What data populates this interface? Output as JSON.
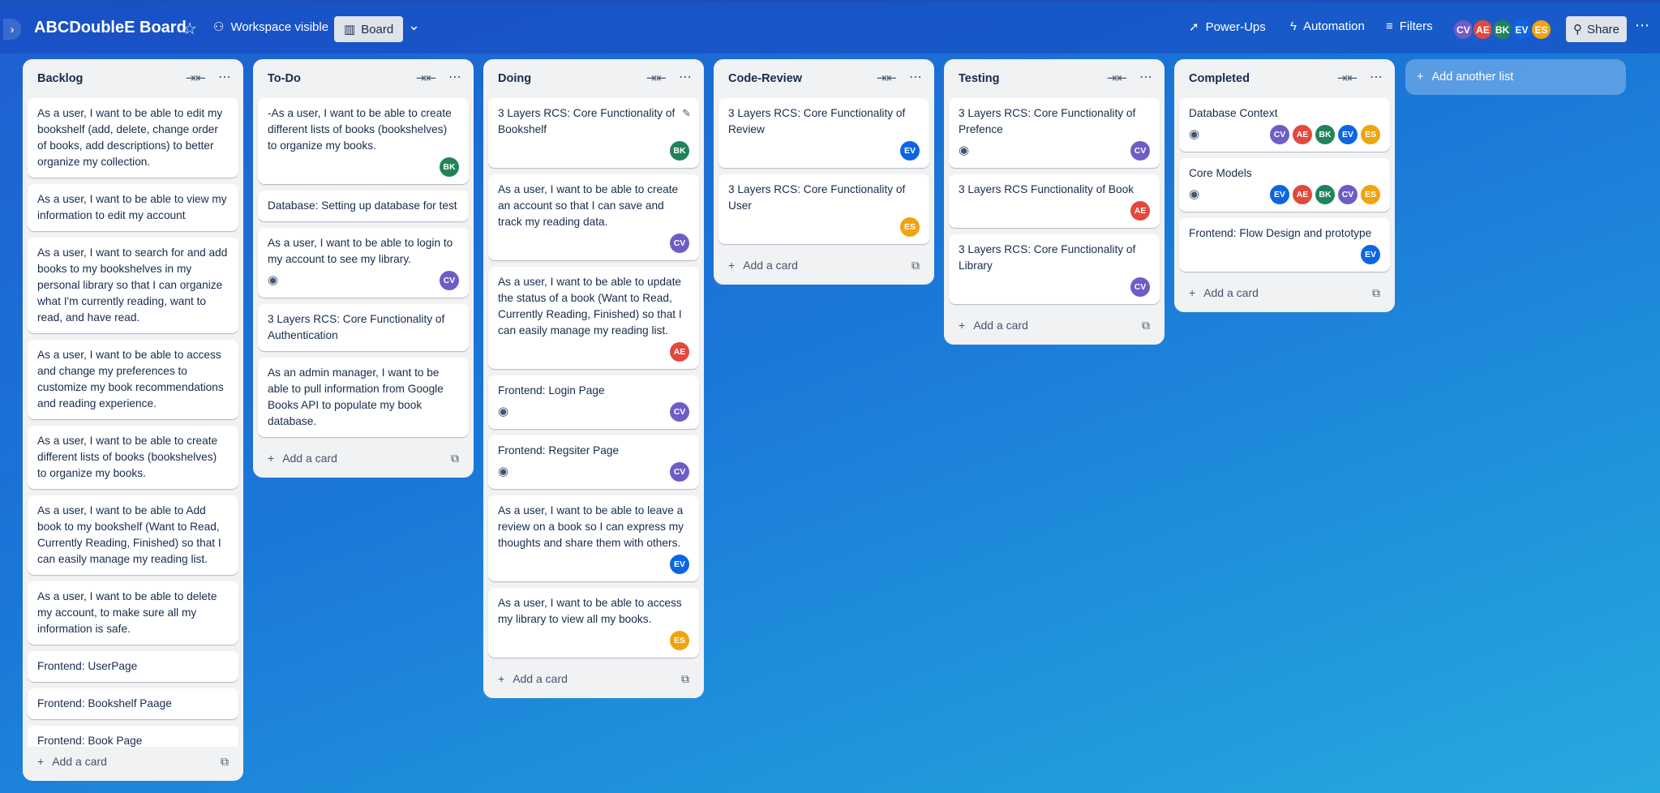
{
  "board": {
    "title": "ABCDoubleE Board",
    "workspace_label": "Workspace visible",
    "view_label": "Board",
    "powerups_label": "Power-Ups",
    "automation_label": "Automation",
    "filters_label": "Filters",
    "share_label": "Share",
    "members": [
      {
        "initials": "CV",
        "color": "#6e5dc6"
      },
      {
        "initials": "AE",
        "color": "#e2483d"
      },
      {
        "initials": "BK",
        "color": "#1f845a"
      },
      {
        "initials": "EV",
        "color": "#0c66e4"
      },
      {
        "initials": "ES",
        "color": "#f0a40e"
      }
    ]
  },
  "colors": {
    "CV": "#6e5dc6",
    "AE": "#e2483d",
    "BK": "#1f845a",
    "EV": "#0c66e4",
    "ES": "#f0a40e"
  },
  "add_card_label": "Add a card",
  "add_list_label": "Add another list",
  "lists": [
    {
      "title": "Backlog",
      "cards": [
        {
          "title": "As a user, I want to be able to edit my bookshelf (add, delete, change order of books, add descriptions) to better organize my collection.",
          "watch": false,
          "members": []
        },
        {
          "title": "As a user, I want to be able to view my information to edit my account",
          "watch": false,
          "members": []
        },
        {
          "title": "As a user, I want to search for and add books to my bookshelves in my personal library so that I can organize what I'm currently reading, want to read, and have read.",
          "watch": false,
          "members": []
        },
        {
          "title": "As a user, I want to be able to access and change my preferences to customize my book recommendations and reading experience.",
          "watch": false,
          "members": []
        },
        {
          "title": "As a user, I want to be able to create different lists of books (bookshelves) to organize my books.",
          "watch": false,
          "members": []
        },
        {
          "title": "As a user, I want to be able to Add book to my bookshelf (Want to Read, Currently Reading, Finished) so that I can easily manage my reading list.",
          "watch": false,
          "members": []
        },
        {
          "title": "As a user, I want to be able to delete my account, to make sure all my information is safe.",
          "watch": false,
          "members": []
        },
        {
          "title": "Frontend: UserPage",
          "watch": false,
          "members": []
        },
        {
          "title": "Frontend: Bookshelf Paage",
          "watch": false,
          "members": []
        },
        {
          "title": "Frontend: Book Page",
          "watch": false,
          "members": []
        }
      ]
    },
    {
      "title": "To-Do",
      "cards": [
        {
          "title": "-As a user, I want to be able to create different lists of books (bookshelves) to organize my books.",
          "watch": false,
          "members": [
            "BK"
          ]
        },
        {
          "title": "Database: Setting up database for test",
          "watch": false,
          "members": []
        },
        {
          "title": "As a user, I want to be able to login to my account to see my library.",
          "watch": true,
          "members": [
            "CV"
          ]
        },
        {
          "title": "3 Layers RCS: Core Functionality of Authentication",
          "watch": false,
          "members": []
        },
        {
          "title": "As an admin manager, I want to be able to pull information from Google Books API to populate my book database.",
          "watch": false,
          "members": []
        }
      ]
    },
    {
      "title": "Doing",
      "cards": [
        {
          "title": "3 Layers RCS: Core Functionality of Bookshelf",
          "watch": false,
          "members": [
            "BK"
          ],
          "edit": true
        },
        {
          "title": "As a user, I want to be able to create an account so that I can save and track my reading data.",
          "watch": false,
          "members": [
            "CV"
          ]
        },
        {
          "title": "As a user, I want to be able to update the status of a book (Want to Read, Currently Reading, Finished) so that I can easily manage my reading list.",
          "watch": false,
          "members": [
            "AE"
          ]
        },
        {
          "title": "Frontend: Login Page",
          "watch": true,
          "members": [
            "CV"
          ]
        },
        {
          "title": "Frontend: Regsiter Page",
          "watch": true,
          "members": [
            "CV"
          ]
        },
        {
          "title": "As a user, I want to be able to leave a review on a book so I can express my thoughts and share them with others.",
          "watch": false,
          "members": [
            "EV"
          ]
        },
        {
          "title": "As a user, I want to be able to access my library to view all my books.",
          "watch": false,
          "members": [
            "ES"
          ]
        }
      ]
    },
    {
      "title": "Code-Review",
      "cards": [
        {
          "title": "3 Layers RCS: Core Functionality of Review",
          "watch": false,
          "members": [
            "EV"
          ]
        },
        {
          "title": "3 Layers RCS: Core Functionality of User",
          "watch": false,
          "members": [
            "ES"
          ]
        }
      ]
    },
    {
      "title": "Testing",
      "cards": [
        {
          "title": "3 Layers RCS: Core Functionality of Prefence",
          "watch": true,
          "members": [
            "CV"
          ]
        },
        {
          "title": "3 Layers RCS Functionality of Book",
          "watch": false,
          "members": [
            "AE"
          ]
        },
        {
          "title": "3 Layers RCS: Core Functionality of Library",
          "watch": false,
          "members": [
            "CV"
          ]
        }
      ]
    },
    {
      "title": "Completed",
      "cards": [
        {
          "title": "Database Context",
          "watch": true,
          "members": [
            "CV",
            "AE",
            "BK",
            "EV",
            "ES"
          ]
        },
        {
          "title": "Core Models",
          "watch": true,
          "members": [
            "EV",
            "AE",
            "BK",
            "CV",
            "ES"
          ]
        },
        {
          "title": "Frontend: Flow Design and prototype",
          "watch": false,
          "members": [
            "EV"
          ]
        }
      ]
    }
  ]
}
